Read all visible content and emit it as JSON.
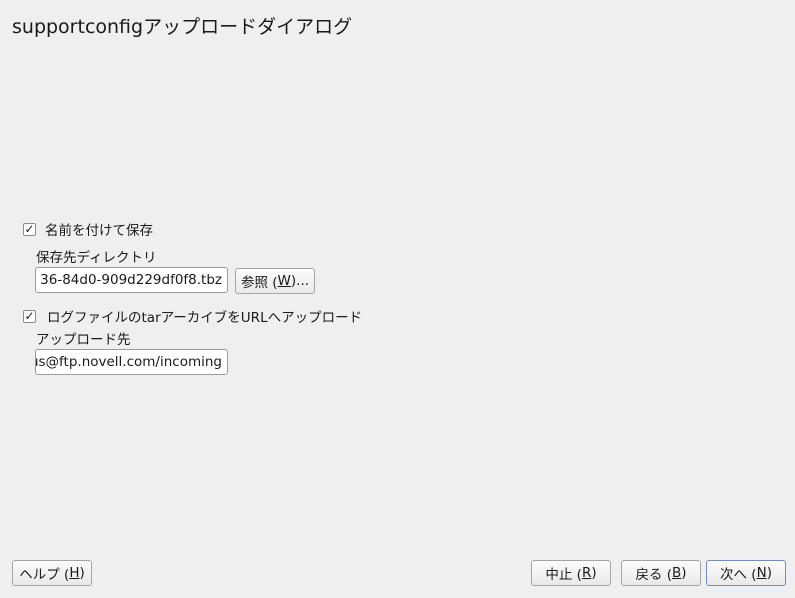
{
  "dialog": {
    "title": "supportconfigアップロードダイアログ"
  },
  "save_section": {
    "checkbox_label": "名前を付けて保存",
    "checked": true,
    "check_glyph": "✓",
    "dir_label": "保存先ディレクトリ",
    "dir_value": "36-84d0-909d229df0f8.tbz",
    "browse_prefix": "参照 (",
    "browse_accel": "W",
    "browse_suffix": ")..."
  },
  "upload_section": {
    "checkbox_label": "ログファイルのtarアーカイブをURLへアップロード",
    "checked": true,
    "check_glyph": "✓",
    "target_label": "アップロード先",
    "target_value": "us@ftp.novell.com/incoming"
  },
  "footer": {
    "help_prefix": "ヘルプ (",
    "help_accel": "H",
    "help_suffix": ")",
    "abort_prefix": "中止 (",
    "abort_accel": "R",
    "abort_suffix": ")",
    "back_prefix": "戻る (",
    "back_accel": "B",
    "back_suffix": ")",
    "next_prefix": "次へ (",
    "next_accel": "N",
    "next_suffix": ")"
  }
}
